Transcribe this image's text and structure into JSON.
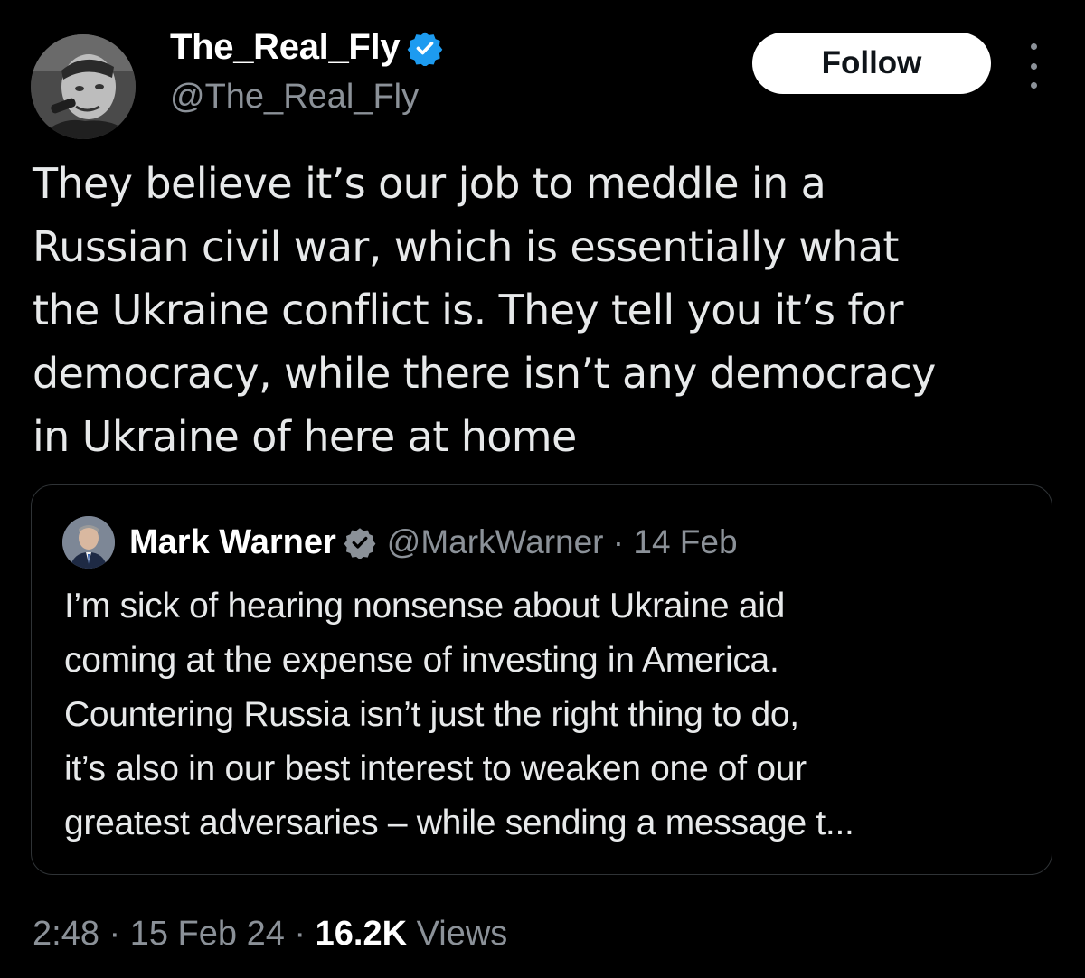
{
  "author": {
    "display_name": "The_Real_Fly",
    "handle": "@The_Real_Fly",
    "verified": true
  },
  "follow_label": "Follow",
  "tweet_text": "They believe it’s our job to meddle in a\nRussian civil war, which is essentially what\nthe Ukraine conflict is. They tell you it’s for\ndemocracy, while there isn’t any democracy\nin Ukraine of here at home",
  "quoted": {
    "display_name": "Mark Warner",
    "handle_date": "@MarkWarner · 14 Feb",
    "verified": true,
    "text": "I’m sick of hearing nonsense about Ukraine aid\ncoming at the expense of investing in America.\nCountering Russia isn’t just the right thing to do,\nit’s also in our best interest to weaken one of our\ngreatest adversaries – while sending a message t..."
  },
  "footer": {
    "timestamp": "2:48 · 15 Feb 24 · ",
    "views_count": "16.2K",
    "views_label": " Views"
  },
  "colors": {
    "background": "#000000",
    "text": "#e7e9ea",
    "muted": "#8b9198",
    "verified_blue": "#1d9bf0",
    "border": "#2f3336"
  }
}
